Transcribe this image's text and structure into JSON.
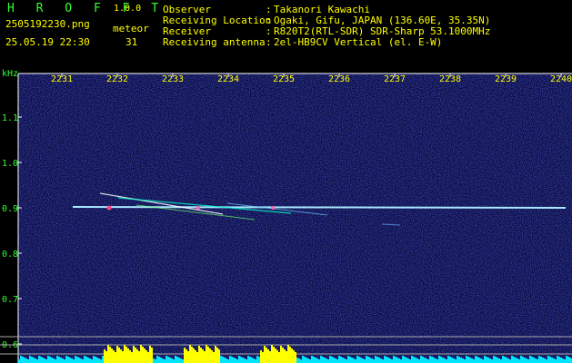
{
  "app": {
    "name": "H R O F F T",
    "version": "1.0.0"
  },
  "file": {
    "name": "2505192230.png",
    "datetime": "25.05.19 22:30"
  },
  "meteor": {
    "label": "meteor",
    "count": "31"
  },
  "info": [
    {
      "label": "Observer",
      "value": "Takanori Kawachi"
    },
    {
      "label": "Receiving Location",
      "value": "Ogaki, Gifu, JAPAN (136.60E, 35.35N)"
    },
    {
      "label": "Receiver",
      "value": "R820T2(RTL-SDR) SDR-Sharp 53.1000MHz"
    },
    {
      "label": "Receiving antenna",
      "value": "2el-HB9CV Vertical (el. E-W)"
    }
  ],
  "axis": {
    "y_unit": "kHz",
    "x_ticks": [
      "2231",
      "2232",
      "2233",
      "2234",
      "2235",
      "2236",
      "2237",
      "2238",
      "2239",
      "2240"
    ],
    "y_ticks": [
      "1.1",
      "1.0",
      "0.9",
      "0.8",
      "0.7",
      "0.6"
    ]
  },
  "colors": {
    "background": "#000000",
    "spectrogram_bg": "#0a0a3c",
    "label_green": "#33ff33",
    "label_yellow": "#ffff00",
    "signal": "#a8e8ff",
    "level_cyan": "#00e5ff",
    "level_yellow": "#ffff00"
  }
}
